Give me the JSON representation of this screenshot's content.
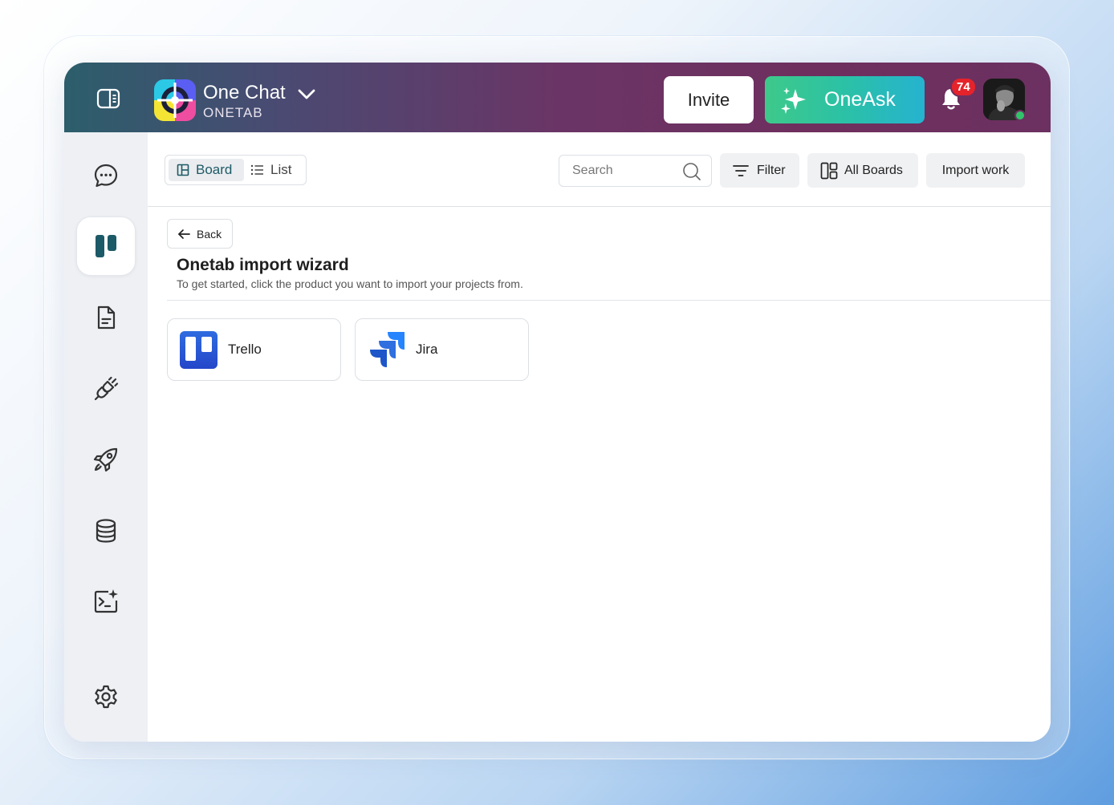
{
  "header": {
    "app_name": "One Chat",
    "app_subtitle": "ONETAB",
    "invite_label": "Invite",
    "oneask_label": "OneAsk",
    "notification_count": "74"
  },
  "rail": {
    "items": [
      {
        "name": "chat",
        "icon": "chat-bubble-icon"
      },
      {
        "name": "boards",
        "icon": "board-icon",
        "active": true
      },
      {
        "name": "documents",
        "icon": "document-icon"
      },
      {
        "name": "integrations",
        "icon": "plug-icon"
      },
      {
        "name": "launch",
        "icon": "rocket-icon"
      },
      {
        "name": "database",
        "icon": "database-icon"
      },
      {
        "name": "ai-terminal",
        "icon": "terminal-sparkle-icon"
      },
      {
        "name": "settings",
        "icon": "gear-icon"
      }
    ]
  },
  "toolbar": {
    "board_label": "Board",
    "list_label": "List",
    "search_placeholder": "Search",
    "filter_label": "Filter",
    "all_boards_label": "All Boards",
    "import_label": "Import work"
  },
  "wizard": {
    "back_label": "Back",
    "title": "Onetab import wizard",
    "subtitle": "To get started, click the product you want to import your projects from.",
    "products": [
      {
        "name": "Trello",
        "color": "#2f5bd8"
      },
      {
        "name": "Jira",
        "color": "#2684ff"
      }
    ]
  },
  "colors": {
    "accent": "#1d5a67",
    "badge": "#e5232b",
    "online": "#31c36a"
  }
}
